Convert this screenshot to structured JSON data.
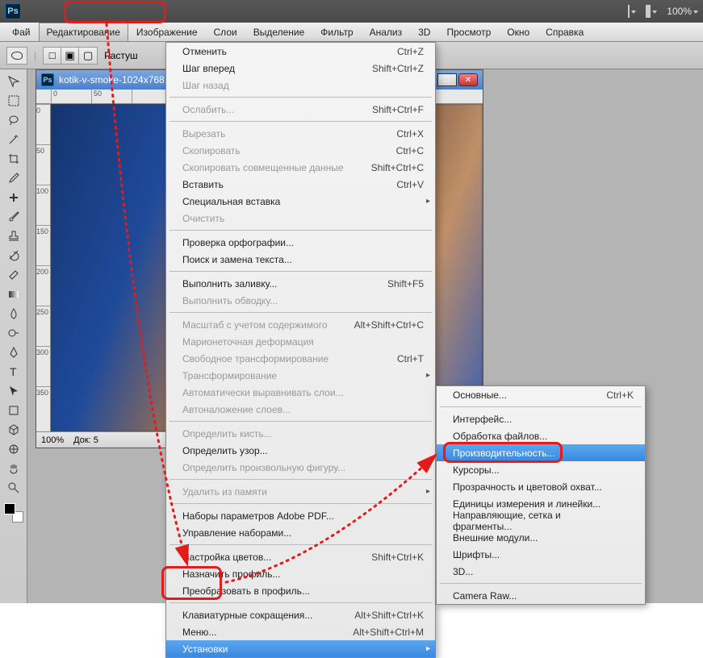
{
  "titlebar": {
    "logo": "Ps",
    "zoom": "100%"
  },
  "menubar": {
    "items": [
      "Фай",
      "Редактирование",
      "Изображение",
      "Слои",
      "Выделение",
      "Фильтр",
      "Анализ",
      "3D",
      "Просмотр",
      "Окно",
      "Справка"
    ]
  },
  "optionsbar": {
    "feather_label": "Растуш"
  },
  "doc": {
    "title": "kotik-v-smoke-1024x768.j...",
    "zoom": "100%",
    "docinfo": "Док: 5",
    "ruler_h": [
      "0",
      "50"
    ],
    "ruler_v": [
      "0",
      "50",
      "100",
      "150",
      "200",
      "250",
      "300",
      "350"
    ]
  },
  "edit_menu": [
    {
      "label": "Отменить",
      "shortcut": "Ctrl+Z"
    },
    {
      "label": "Шаг вперед",
      "shortcut": "Shift+Ctrl+Z"
    },
    {
      "label": "Шаг назад",
      "shortcut": "",
      "disabled": true
    },
    {
      "sep": true
    },
    {
      "label": "Ослабить...",
      "shortcut": "Shift+Ctrl+F",
      "disabled": true
    },
    {
      "sep": true
    },
    {
      "label": "Вырезать",
      "shortcut": "Ctrl+X",
      "disabled": true
    },
    {
      "label": "Скопировать",
      "shortcut": "Ctrl+C",
      "disabled": true
    },
    {
      "label": "Скопировать совмещенные данные",
      "shortcut": "Shift+Ctrl+C",
      "disabled": true
    },
    {
      "label": "Вставить",
      "shortcut": "Ctrl+V"
    },
    {
      "label": "Специальная вставка",
      "has_sub": true
    },
    {
      "label": "Очистить",
      "disabled": true
    },
    {
      "sep": true
    },
    {
      "label": "Проверка орфографии..."
    },
    {
      "label": "Поиск и замена текста..."
    },
    {
      "sep": true
    },
    {
      "label": "Выполнить заливку...",
      "shortcut": "Shift+F5"
    },
    {
      "label": "Выполнить обводку...",
      "disabled": true
    },
    {
      "sep": true
    },
    {
      "label": "Масштаб с учетом содержимого",
      "shortcut": "Alt+Shift+Ctrl+C",
      "disabled": true
    },
    {
      "label": "Марионеточная деформация",
      "disabled": true
    },
    {
      "label": "Свободное трансформирование",
      "shortcut": "Ctrl+T",
      "disabled": true
    },
    {
      "label": "Трансформирование",
      "has_sub": true,
      "disabled": true
    },
    {
      "label": "Автоматически выравнивать слои...",
      "disabled": true
    },
    {
      "label": "Автоналожение слоев...",
      "disabled": true
    },
    {
      "sep": true
    },
    {
      "label": "Определить кисть...",
      "disabled": true
    },
    {
      "label": "Определить узор..."
    },
    {
      "label": "Определить произвольную фигуру...",
      "disabled": true
    },
    {
      "sep": true
    },
    {
      "label": "Удалить из памяти",
      "has_sub": true,
      "disabled": true
    },
    {
      "sep": true
    },
    {
      "label": "Наборы параметров Adobe PDF..."
    },
    {
      "label": "Управление наборами..."
    },
    {
      "sep": true
    },
    {
      "label": "Настройка цветов...",
      "shortcut": "Shift+Ctrl+K"
    },
    {
      "label": "Назначить профиль..."
    },
    {
      "label": "Преобразовать в профиль..."
    },
    {
      "sep": true
    },
    {
      "label": "Клавиатурные сокращения...",
      "shortcut": "Alt+Shift+Ctrl+K"
    },
    {
      "label": "Меню...",
      "shortcut": "Alt+Shift+Ctrl+M"
    },
    {
      "label": "Установки",
      "has_sub": true,
      "hover": true
    }
  ],
  "prefs_menu": [
    {
      "label": "Основные...",
      "shortcut": "Ctrl+K"
    },
    {
      "sep": true
    },
    {
      "label": "Интерфейс..."
    },
    {
      "label": "Обработка файлов..."
    },
    {
      "label": "Производительность...",
      "hover": true
    },
    {
      "label": "Курсоры..."
    },
    {
      "label": "Прозрачность и цветовой охват..."
    },
    {
      "label": "Единицы измерения и линейки..."
    },
    {
      "label": "Направляющие, сетка и фрагменты..."
    },
    {
      "label": "Внешние модули..."
    },
    {
      "label": "Шрифты..."
    },
    {
      "label": "3D..."
    },
    {
      "sep": true
    },
    {
      "label": "Camera Raw..."
    }
  ]
}
